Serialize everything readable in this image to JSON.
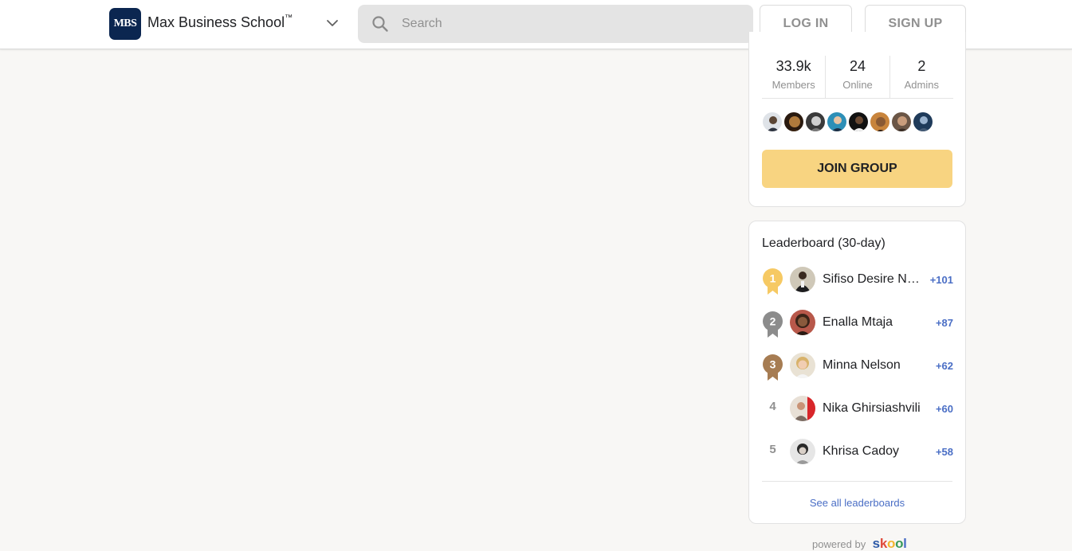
{
  "header": {
    "logo_text": "MBS",
    "group_name": "Max Business School",
    "trademark": "™",
    "search_placeholder": "Search",
    "login_label": "LOG IN",
    "signup_label": "SIGN UP"
  },
  "about": {
    "stats": [
      {
        "value": "33.9k",
        "label": "Members"
      },
      {
        "value": "24",
        "label": "Online"
      },
      {
        "value": "2",
        "label": "Admins"
      }
    ],
    "join_label": "JOIN GROUP"
  },
  "leaderboard": {
    "title": "Leaderboard (30-day)",
    "entries": [
      {
        "rank": "1",
        "name": "Sifiso Desire Ndlovu",
        "points": "+101"
      },
      {
        "rank": "2",
        "name": "Enalla Mtaja",
        "points": "+87"
      },
      {
        "rank": "3",
        "name": "Minna Nelson",
        "points": "+62"
      },
      {
        "rank": "4",
        "name": "Nika Ghirsiashvili",
        "points": "+60"
      },
      {
        "rank": "5",
        "name": "Khrisa Cadoy",
        "points": "+58"
      }
    ],
    "see_all_label": "See all leaderboards"
  },
  "footer": {
    "powered_by": "powered by",
    "brand": "skool"
  },
  "colors": {
    "page_bg": "#f8f7f5",
    "accent_link": "#4a6ec5",
    "join_button": "#f8d481",
    "gold": "#f6c963",
    "silver": "#8c8c8c",
    "bronze": "#a67c52",
    "logo_bg": "#0b2650"
  }
}
